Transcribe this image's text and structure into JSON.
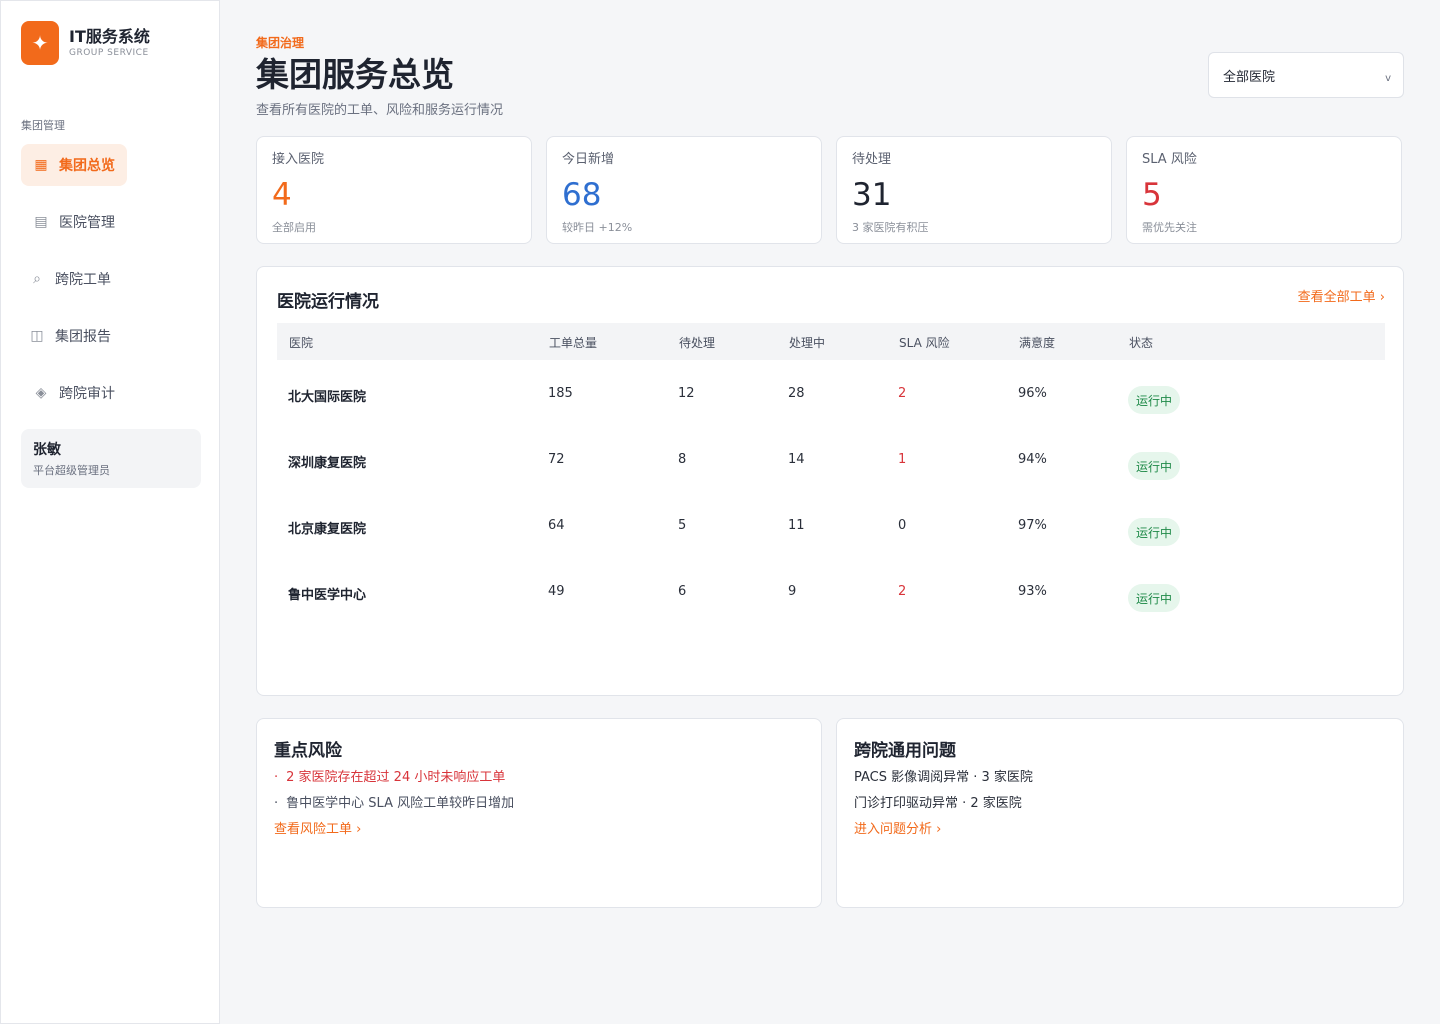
{
  "brand": {
    "logo_icon": "sparkle-icon",
    "name": "IT服务系统",
    "sub": "GROUP SERVICE"
  },
  "sidebar": {
    "section": "集团管理",
    "items": [
      {
        "label": "集团总览",
        "icon": "grid-icon",
        "active": true
      },
      {
        "label": "医院管理",
        "icon": "list-icon"
      },
      {
        "label": "跨院工单",
        "icon": "search-icon"
      },
      {
        "label": "集团报告",
        "icon": "book-icon"
      },
      {
        "label": "跨院审计",
        "icon": "diamond-icon"
      }
    ],
    "user": {
      "name": "张敏",
      "role": "平台超级管理员"
    }
  },
  "header": {
    "eyebrow": "集团治理",
    "title": "集团服务总览",
    "subtitle": "查看所有医院的工单、风险和服务运行情况",
    "select_value": "全部医院"
  },
  "stats": [
    {
      "label": "接入医院",
      "value": "4",
      "note": "全部启用",
      "color": "#f26a1b"
    },
    {
      "label": "今日新增",
      "value": "68",
      "note": "较昨日 +12%",
      "color": "#2f6fd0"
    },
    {
      "label": "待处理",
      "value": "31",
      "note": "3 家医院有积压",
      "color": "#1f2430"
    },
    {
      "label": "SLA 风险",
      "value": "5",
      "note": "需优先关注",
      "color": "#d8343a"
    }
  ],
  "table": {
    "title": "医院运行情况",
    "view_all": "查看全部工单 ›",
    "columns": [
      "医院",
      "工单总量",
      "待处理",
      "处理中",
      "SLA 风险",
      "满意度",
      "状态"
    ],
    "rows": [
      {
        "hospital": "北大国际医院",
        "total": "185",
        "pending": "12",
        "processing": "28",
        "sla": "2",
        "satisfaction": "96%",
        "status": "运行中"
      },
      {
        "hospital": "深圳康复医院",
        "total": "72",
        "pending": "8",
        "processing": "14",
        "sla": "1",
        "satisfaction": "94%",
        "status": "运行中"
      },
      {
        "hospital": "北京康复医院",
        "total": "64",
        "pending": "5",
        "processing": "11",
        "sla": "0",
        "satisfaction": "97%",
        "status": "运行中"
      },
      {
        "hospital": "鲁中医学中心",
        "total": "49",
        "pending": "6",
        "processing": "9",
        "sla": "2",
        "satisfaction": "93%",
        "status": "运行中"
      }
    ]
  },
  "risk": {
    "title": "重点风险",
    "items": [
      "2 家医院存在超过 24 小时未响应工单",
      "鲁中医学中心 SLA 风险工单较昨日增加"
    ],
    "link": "查看风险工单 ›"
  },
  "common": {
    "title": "跨院通用问题",
    "items": [
      "PACS 影像调阅异常 · 3 家医院",
      "门诊打印驱动异常 · 2 家医院"
    ],
    "link": "进入问题分析 ›"
  },
  "colors": {
    "accent": "#f26a1b",
    "danger": "#d8343a",
    "success": "#1f8a48"
  }
}
